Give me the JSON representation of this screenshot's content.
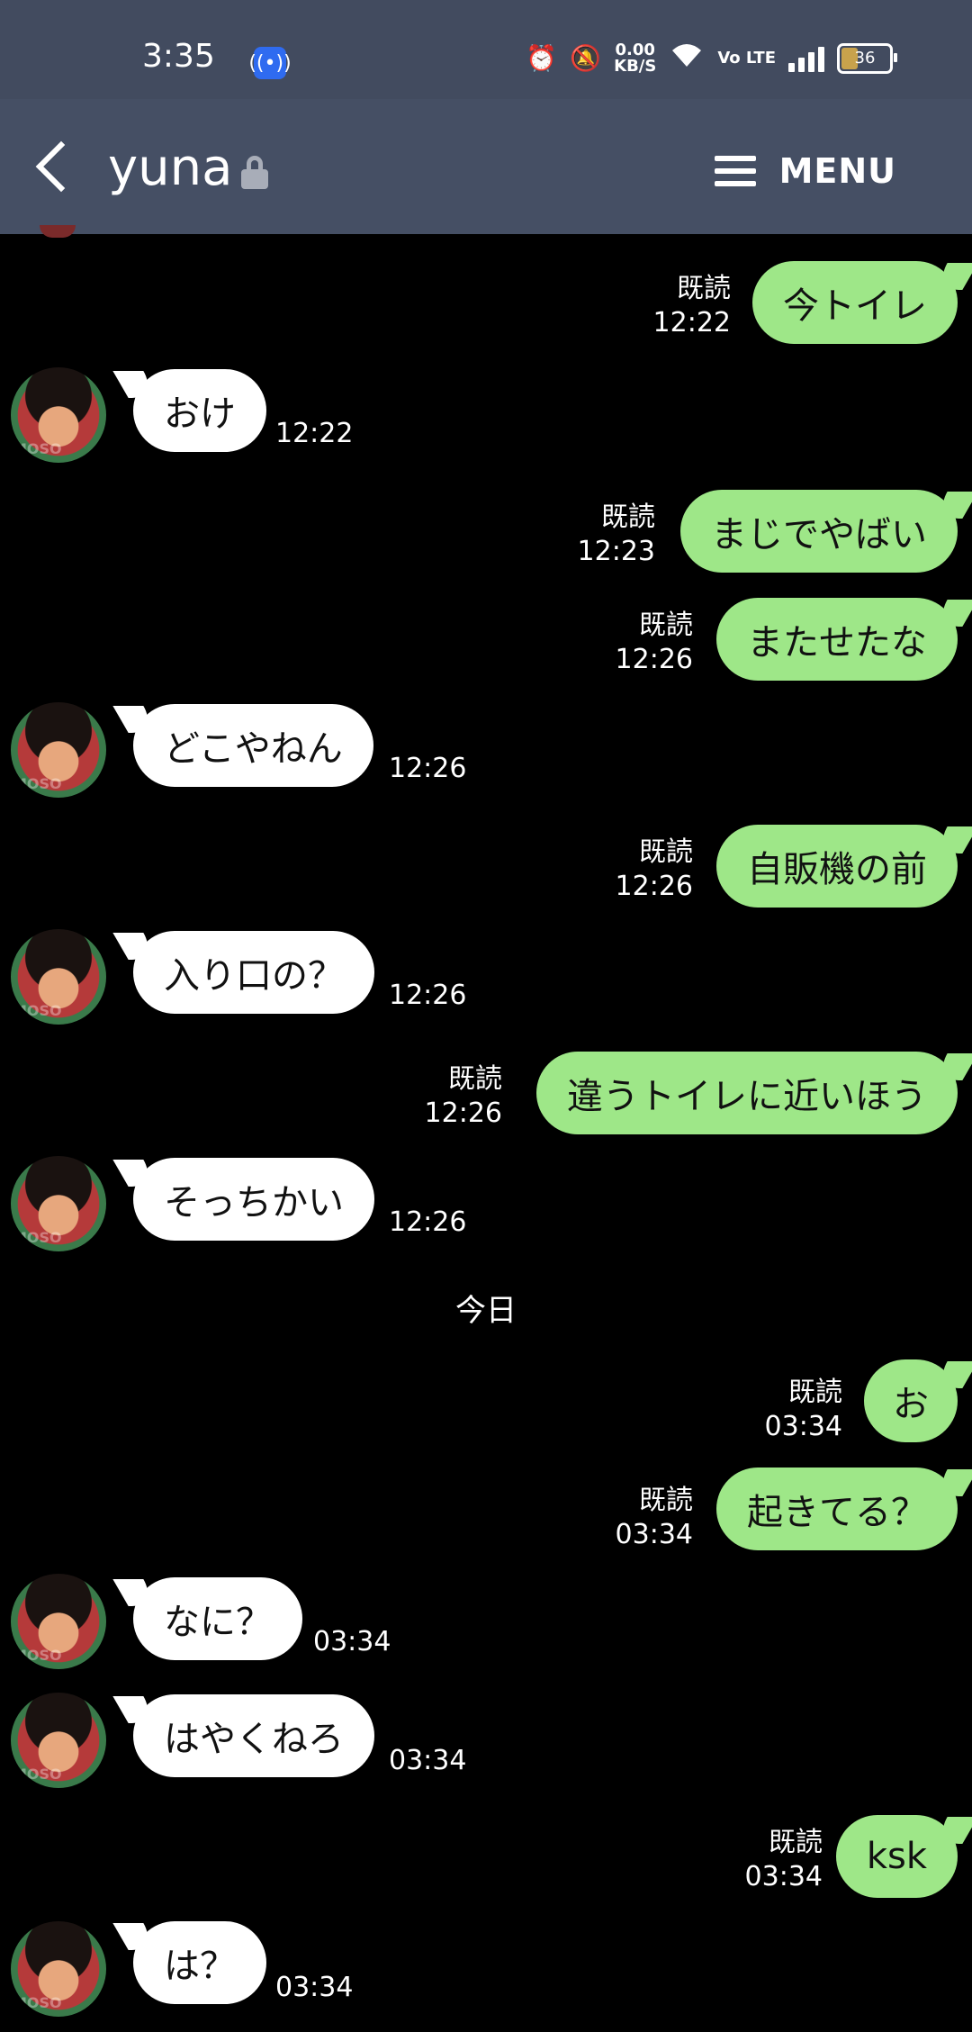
{
  "status_bar": {
    "time": "3:35",
    "speed_value": "0.00",
    "speed_unit": "KB/S",
    "volte": "Vo LTE",
    "battery": "36"
  },
  "header": {
    "title": "yuna",
    "menu_label": "MENU"
  },
  "avatar_watermark": "MOSO",
  "messages": [
    {
      "dir": "out",
      "text": "今トイレ",
      "read": "既読",
      "time": "12:22"
    },
    {
      "dir": "in",
      "text": "おけ",
      "time": "12:22"
    },
    {
      "dir": "out",
      "text": "まじでやばい",
      "read": "既読",
      "time": "12:23"
    },
    {
      "dir": "out",
      "text": "またせたな",
      "read": "既読",
      "time": "12:26"
    },
    {
      "dir": "in",
      "text": "どこやねん",
      "time": "12:26"
    },
    {
      "dir": "out",
      "text": "自販機の前",
      "read": "既読",
      "time": "12:26"
    },
    {
      "dir": "in",
      "text": "入り口の？",
      "time": "12:26"
    },
    {
      "dir": "out",
      "text": "違うトイレに近いほう",
      "read": "既読",
      "time": "12:26"
    },
    {
      "dir": "in",
      "text": "そっちかい",
      "time": "12:26"
    },
    {
      "dir": "out",
      "text": "お",
      "read": "既読",
      "time": "03:34"
    },
    {
      "dir": "out",
      "text": "起きてる？",
      "read": "既読",
      "time": "03:34"
    },
    {
      "dir": "in",
      "text": "なに？",
      "time": "03:34"
    },
    {
      "dir": "in",
      "text": "はやくねろ",
      "time": "03:34"
    },
    {
      "dir": "out",
      "text": "ksk",
      "read": "既読",
      "time": "03:34"
    },
    {
      "dir": "in",
      "text": "は？",
      "time": "03:34"
    }
  ],
  "day_separator": "今日"
}
